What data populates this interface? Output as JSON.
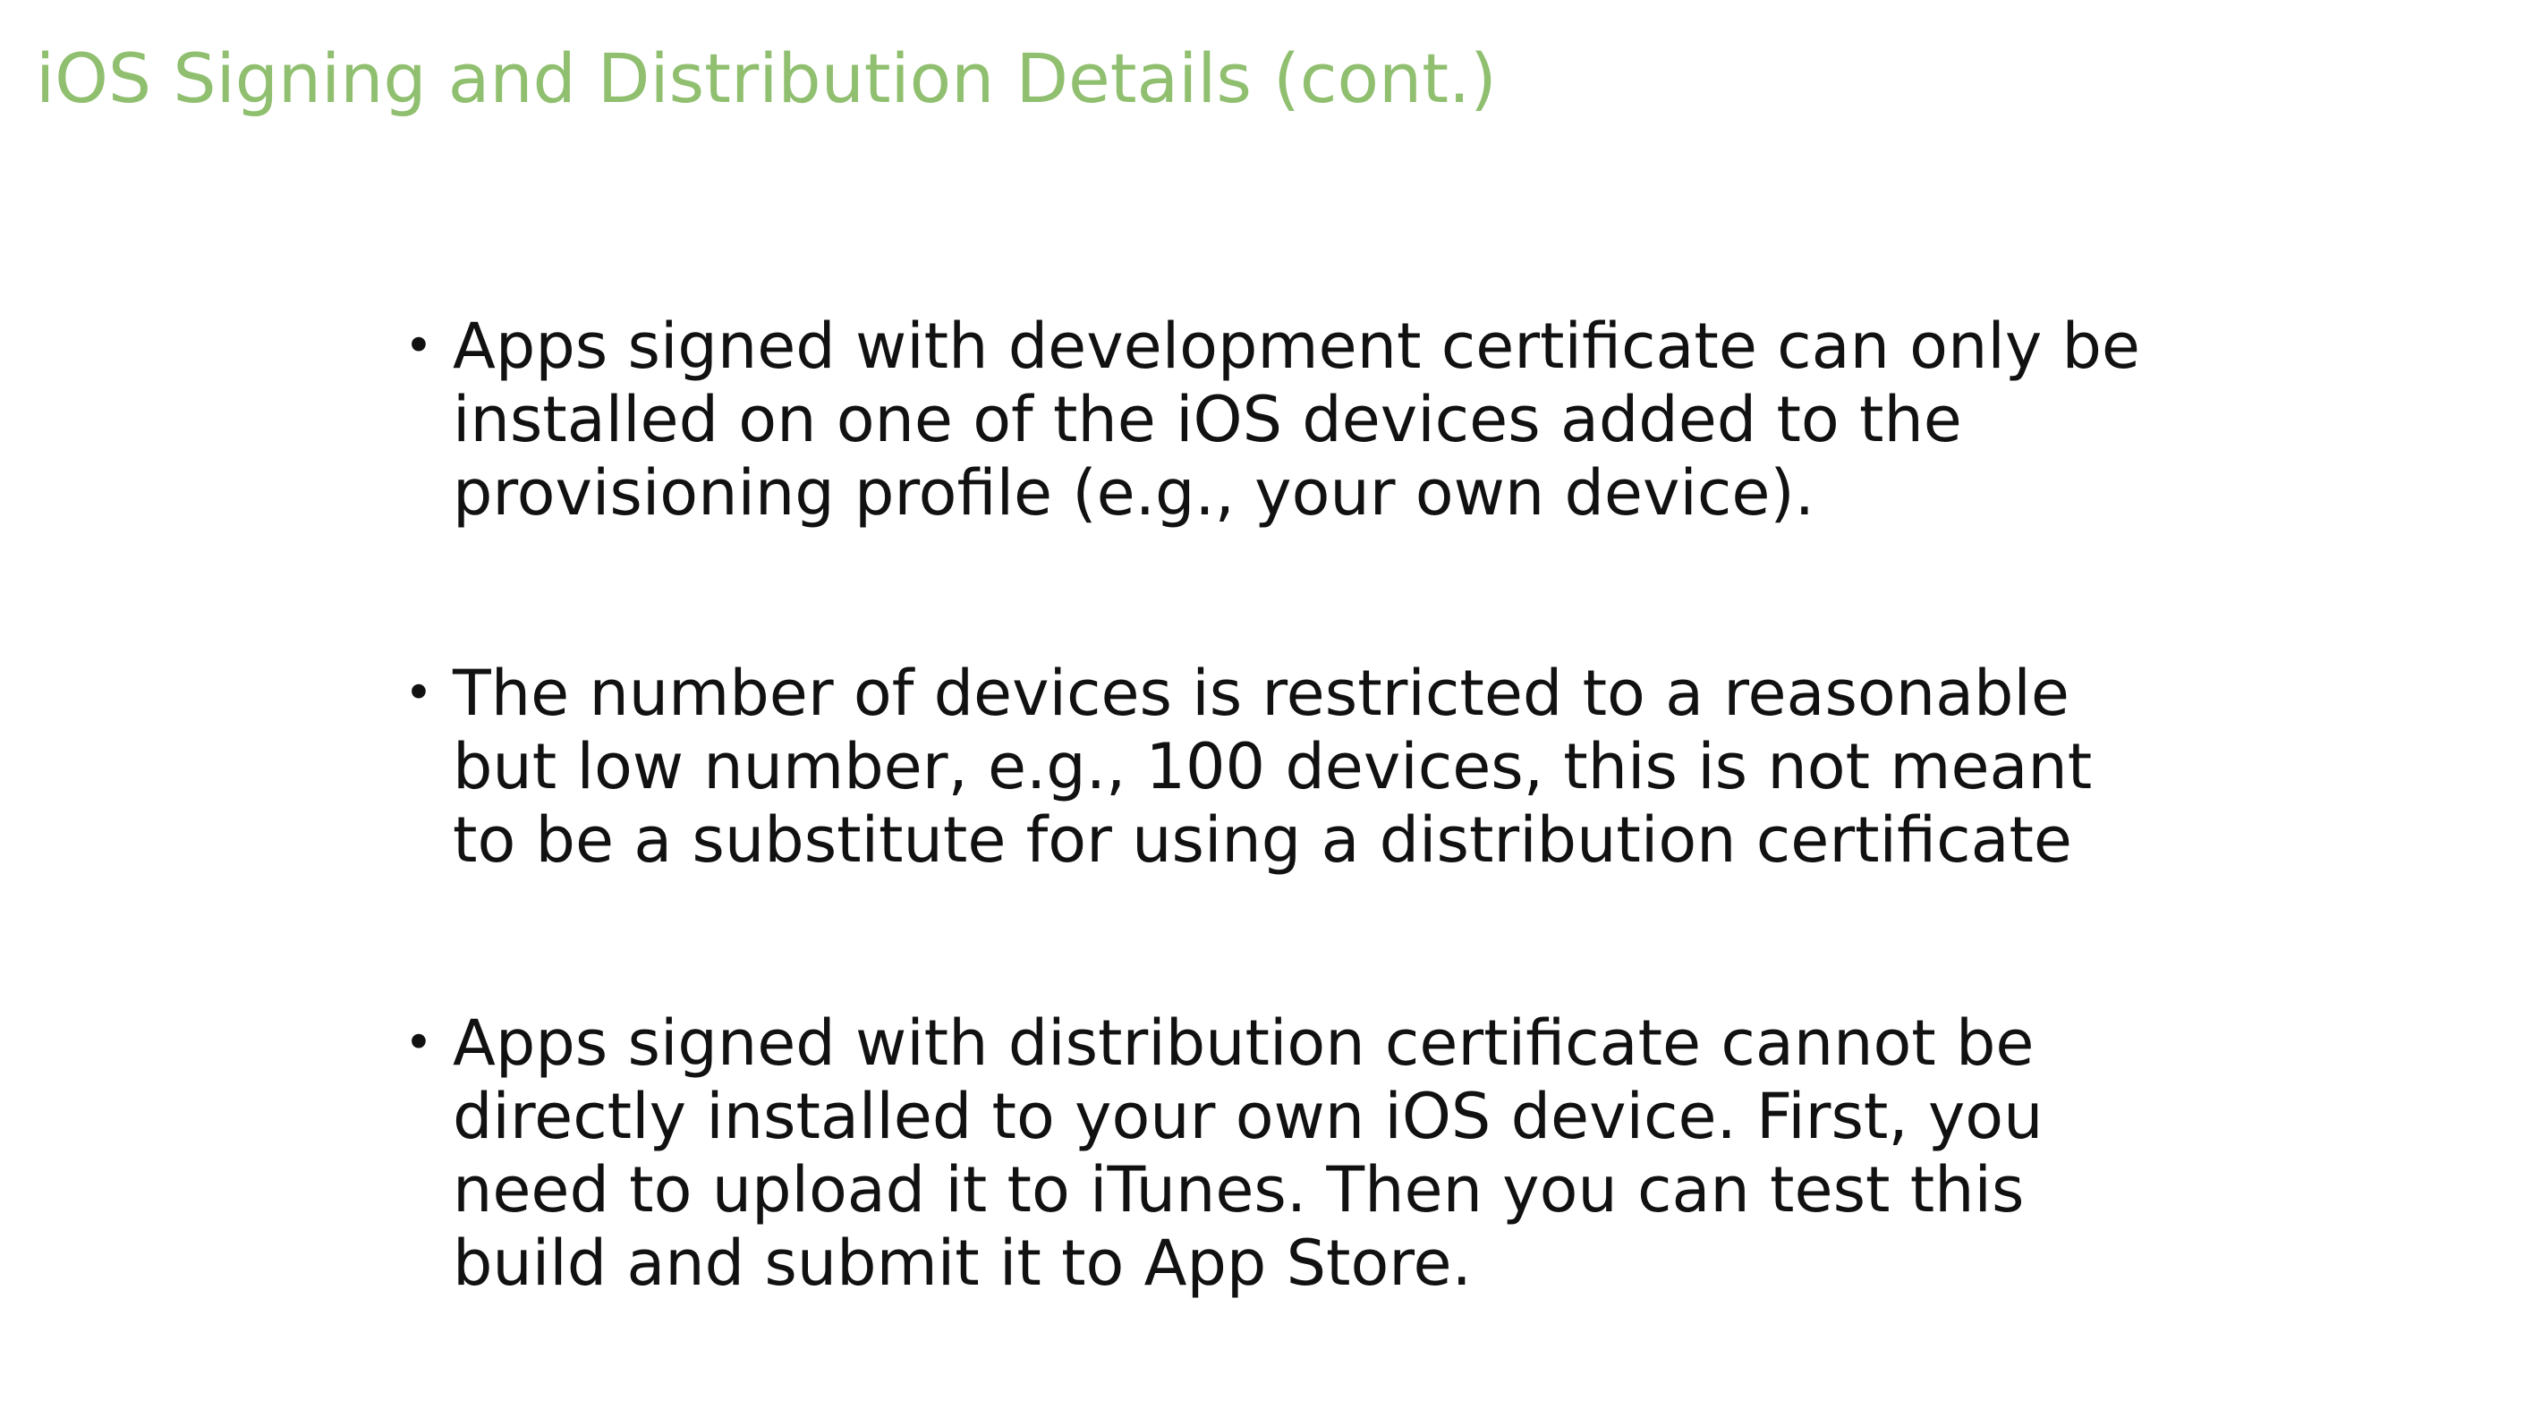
{
  "slide": {
    "title": "iOS Signing and Distribution Details (cont.)",
    "bullets": [
      {
        "marker": "•",
        "lines": [
          "Apps signed with development certificate can only be",
          "installed on one of the iOS devices added to the",
          "provisioning profile (e.g., your own device)."
        ]
      },
      {
        "marker": "•",
        "lines": [
          "The number of devices is restricted to a reasonable",
          "but low number, e.g., 100 devices, this is not meant",
          "to be a substitute for using a distribution certificate"
        ]
      },
      {
        "marker": "•",
        "lines": [
          "Apps signed with distribution certificate cannot be",
          "directly installed to your own iOS device. First, you",
          "need to upload it to iTunes.  Then you can test this",
          "build and submit it to App Store."
        ]
      }
    ]
  },
  "colors": {
    "title": "#8fbf6f",
    "text": "#111111",
    "background": "#ffffff"
  }
}
